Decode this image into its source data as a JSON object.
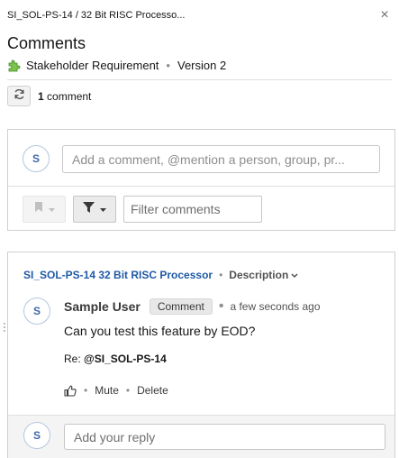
{
  "header": {
    "breadcrumb": "SI_SOL-PS-14 / 32 Bit RISC Processo...",
    "close_icon": "×",
    "title": "Comments"
  },
  "artifact": {
    "icon": "puzzle-icon",
    "type": "Stakeholder Requirement",
    "separator": "•",
    "version": "Version 2"
  },
  "toolbar": {
    "refresh_icon": "refresh-icon",
    "count": "1",
    "count_label": "comment"
  },
  "compose": {
    "avatar_initial": "S",
    "placeholder": "Add a comment, @mention a person, group, pr...",
    "bookmark_icon": "bookmark-icon",
    "filter_icon": "filter-icon",
    "filter_placeholder": "Filter comments"
  },
  "thread": {
    "link": "SI_SOL-PS-14 32 Bit RISC Processor",
    "separator": "•",
    "section": "Description",
    "comment": {
      "avatar_initial": "S",
      "author": "Sample User",
      "tag": "Comment",
      "separator": "•",
      "timestamp": "a few seconds ago",
      "body": "Can you test this feature by EOD?",
      "re_prefix": "Re:",
      "re_target": "@SI_SOL-PS-14",
      "actions": {
        "like_icon": "thumbs-up-icon",
        "mute": "Mute",
        "delete": "Delete",
        "separator": "•"
      }
    },
    "reply": {
      "avatar_initial": "S",
      "placeholder": "Add your reply"
    }
  },
  "colors": {
    "link": "#1f5aa6",
    "avatar_text": "#3f68a8",
    "puzzle_green": "#5aa832"
  }
}
